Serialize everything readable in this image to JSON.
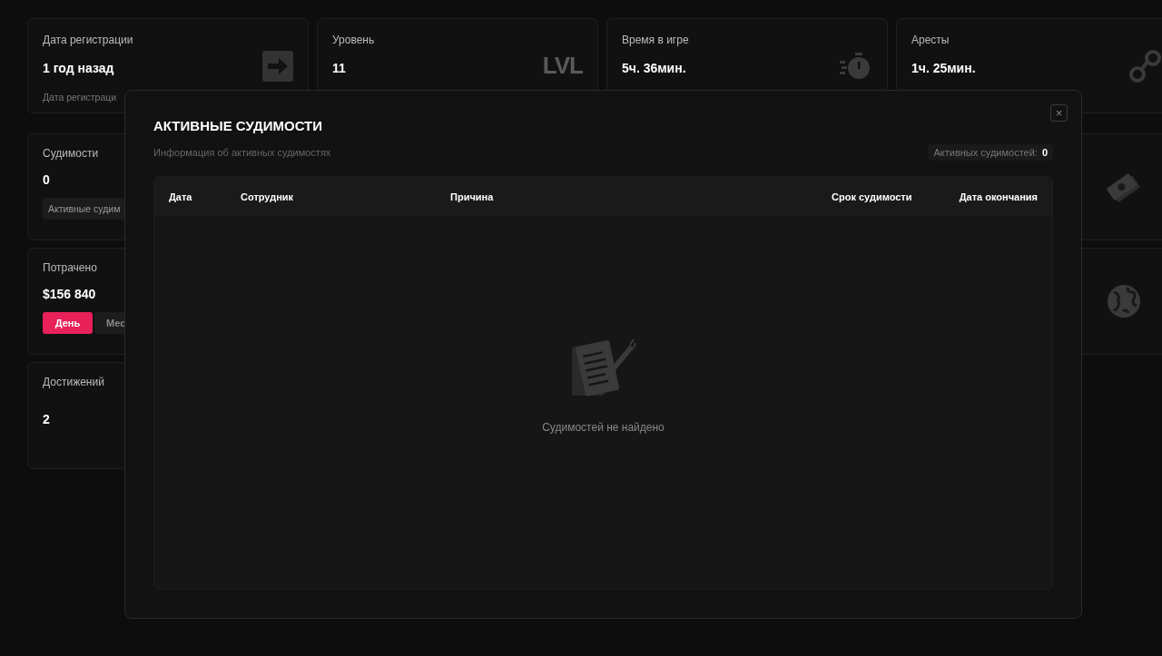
{
  "stat_cards": [
    {
      "label": "Дата регистрации",
      "value": "1 год назад",
      "note": "Дата регистраци"
    },
    {
      "label": "Уровень",
      "value": "11",
      "icon_text": "LVL"
    },
    {
      "label": "Время в игре",
      "value": "5ч. 36мин."
    },
    {
      "label": "Аресты",
      "value": "1ч. 25мин."
    }
  ],
  "left_cards": [
    {
      "label": "Судимости",
      "value": "0",
      "button": "Активные судим"
    },
    {
      "label": "Потрачено",
      "value": "$156 840",
      "periods": [
        {
          "label": "День",
          "selected": true
        },
        {
          "label": "Мес",
          "selected": false
        }
      ]
    },
    {
      "label": "Достижений",
      "value": "2"
    }
  ],
  "modal": {
    "title": "АКТИВНЫЕ СУДИМОСТИ",
    "close_label": "×",
    "subtitle": "Информация об активных судимостях",
    "count_label": "Активных судимостей:",
    "count": "0",
    "table": {
      "columns": [
        "Дата",
        "Сотрудник",
        "Причина",
        "Срок судимости",
        "Дата окончания"
      ],
      "empty_text": "Судимостей не найдено"
    }
  }
}
